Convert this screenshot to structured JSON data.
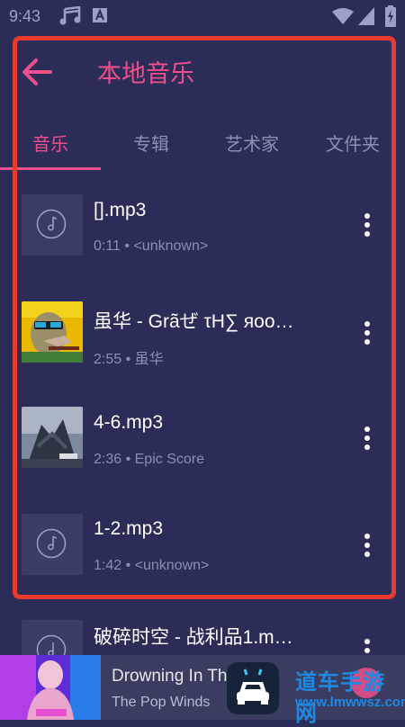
{
  "status_bar": {
    "time": "9:43"
  },
  "header": {
    "title": "本地音乐"
  },
  "tabs": [
    {
      "label": "音乐",
      "active": true
    },
    {
      "label": "专辑",
      "active": false
    },
    {
      "label": "艺术家",
      "active": false
    },
    {
      "label": "文件夹",
      "active": false
    }
  ],
  "tracks": [
    {
      "title": "[].mp3",
      "meta": "0:11 • <unknown>",
      "cover": "default-disc"
    },
    {
      "title": "虽华 - Grãぜ τΗ∑ яoo…",
      "meta": "2:55 • 虽华",
      "cover": "zombie-art"
    },
    {
      "title": "4-6.mp3",
      "meta": "2:36 • Epic Score",
      "cover": "epic-art"
    },
    {
      "title": "1-2.mp3",
      "meta": "1:42 • <unknown>",
      "cover": "default-disc"
    },
    {
      "title": "破碎时空 - 战利品1.m…",
      "meta": "",
      "cover": "default-disc"
    }
  ],
  "now_playing": {
    "title": "Drowning In The Dark",
    "artist": "The Pop Winds"
  },
  "watermark": {
    "name": "道车手游网",
    "url": "www.lmwwsz.com"
  },
  "colors": {
    "accent": "#ef4f8b",
    "background": "#2b2d58",
    "highlight": "#ea3a2d"
  }
}
